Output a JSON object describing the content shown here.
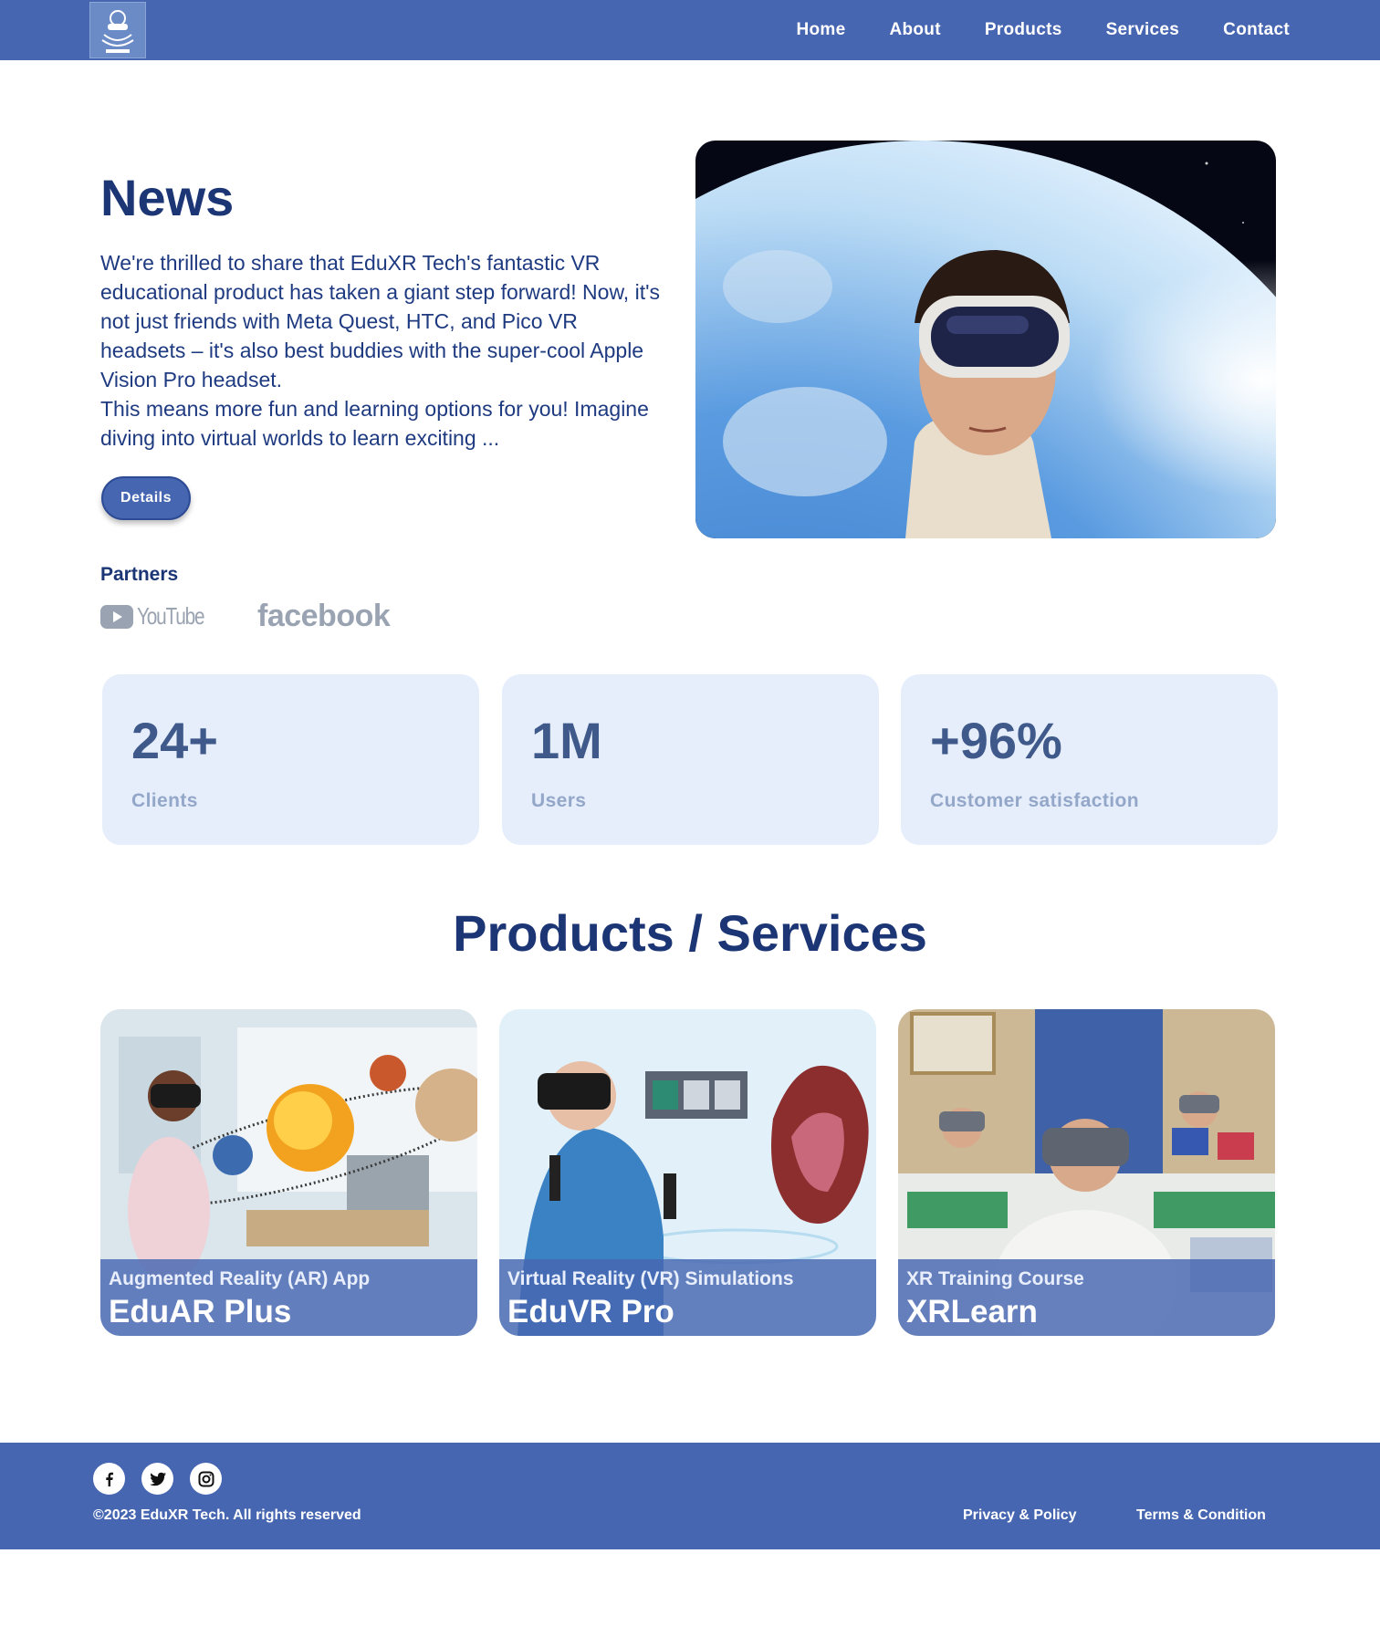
{
  "nav": {
    "logo_icon": "eduxr-logo-icon",
    "links": [
      "Home",
      "About",
      "Products",
      "Services",
      "Contact"
    ]
  },
  "news": {
    "title": "News",
    "paragraph_1": "We're thrilled to share that EduXR Tech's fantastic VR educational product has taken a giant step forward! Now, it's not just friends with Meta Quest, HTC, and Pico VR headsets – it's also best buddies with the super-cool Apple Vision Pro headset.",
    "paragraph_2": "This means more fun and learning options for you! Imagine diving into virtual worlds to learn exciting ...",
    "details_label": "Details",
    "image_icon": "vr-headset-earth-image"
  },
  "partners": {
    "label": "Partners",
    "youtube": "YouTube",
    "facebook": "facebook"
  },
  "stats": [
    {
      "value": "24+",
      "label": "Clients"
    },
    {
      "value": "1M",
      "label": "Users"
    },
    {
      "value": "+96%",
      "label": "Customer satisfaction"
    }
  ],
  "products": {
    "title": "Products / Services",
    "cards": [
      {
        "subtitle": "Augmented Reality (AR) App",
        "name": "EduAR Plus",
        "image_icon": "ar-solar-system-image"
      },
      {
        "subtitle": "Virtual Reality (VR) Simulations",
        "name": "EduVR Pro",
        "image_icon": "vr-heart-anatomy-image"
      },
      {
        "subtitle": "XR Training Course",
        "name": "XRLearn",
        "image_icon": "vr-classroom-image"
      }
    ]
  },
  "footer": {
    "social_icons": [
      "facebook-icon",
      "twitter-icon",
      "instagram-icon"
    ],
    "copyright": "©2023 EduXR Tech. All rights reserved",
    "privacy": "Privacy & Policy",
    "terms": "Terms & Condition"
  },
  "colors": {
    "primary": "#4766b1",
    "heading": "#1b3575",
    "stat_bg": "#e6edfb"
  }
}
